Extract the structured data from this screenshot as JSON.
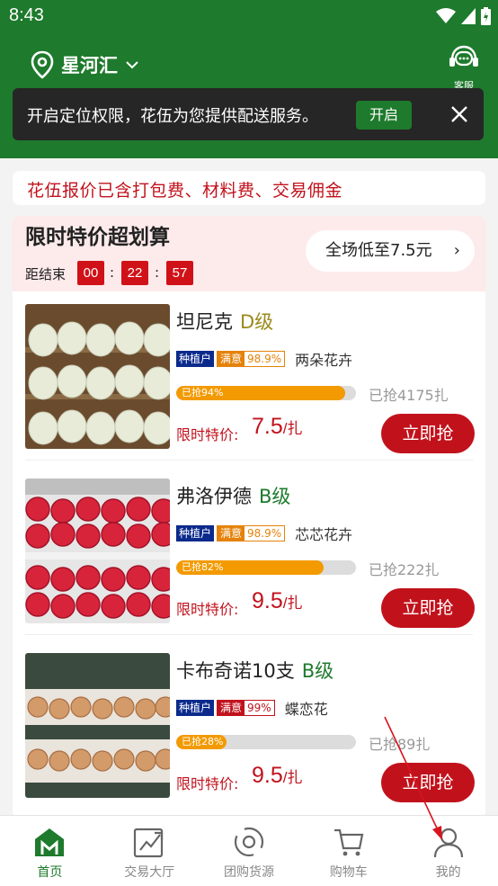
{
  "status": {
    "time": "8:43"
  },
  "header": {
    "location": "星河汇",
    "service_label": "客服"
  },
  "toast": {
    "message": "开启定位权限，花伍为您提供配送服务。",
    "open_label": "开启"
  },
  "notice": "花伍报价已含打包费、材料费、交易佣金",
  "flash_sale": {
    "title": "限时特价超划算",
    "countdown_label": "距结束",
    "countdown": [
      "00",
      "22",
      "57"
    ],
    "lowest_label": "全场低至7.5元",
    "items": [
      {
        "name": "坦尼克",
        "grade": "D级",
        "grade_color": "#9a8a1a",
        "grower_tag": "种植户",
        "sat_label": "满意",
        "sat_value": "98.9%",
        "shop": "两朵花卉",
        "progress_label": "已抢94%",
        "progress": 0.94,
        "grabbed": "已抢4175扎",
        "price_label": "限时特价:",
        "price": "7.5",
        "unit": "/扎",
        "buy_label": "立即抢",
        "image": "white-hydrangea"
      },
      {
        "name": "弗洛伊德",
        "grade": "B级",
        "grade_color": "#1e7a2c",
        "grower_tag": "种植户",
        "sat_label": "满意",
        "sat_value": "98.9%",
        "shop": "芯芯花卉",
        "progress_label": "已抢82%",
        "progress": 0.82,
        "grabbed": "已抢222扎",
        "price_label": "限时特价:",
        "price": "9.5",
        "unit": "/扎",
        "buy_label": "立即抢",
        "image": "red-roses"
      },
      {
        "name": "卡布奇诺10支",
        "grade": "B级",
        "grade_color": "#1e7a2c",
        "grower_tag": "种植户",
        "sat_label": "满意",
        "sat_value": "99%",
        "shop": "蝶恋花",
        "progress_label": "已抢28%",
        "progress": 0.28,
        "grabbed": "已抢89扎",
        "price_label": "限时特价:",
        "price": "9.5",
        "unit": "/扎",
        "buy_label": "立即抢",
        "image": "cappuccino-roses"
      }
    ]
  },
  "bottom_nav": [
    {
      "label": "首页",
      "icon": "home-icon",
      "active": true
    },
    {
      "label": "交易大厅",
      "icon": "trade-chart-icon",
      "active": false
    },
    {
      "label": "团购货源",
      "icon": "group-buy-icon",
      "active": false
    },
    {
      "label": "购物车",
      "icon": "cart-icon",
      "active": false
    },
    {
      "label": "我的",
      "icon": "user-icon",
      "active": false
    }
  ],
  "colors": {
    "brand": "#1e7a2c",
    "accent_red": "#c1121c",
    "progress": "#f39a00"
  }
}
